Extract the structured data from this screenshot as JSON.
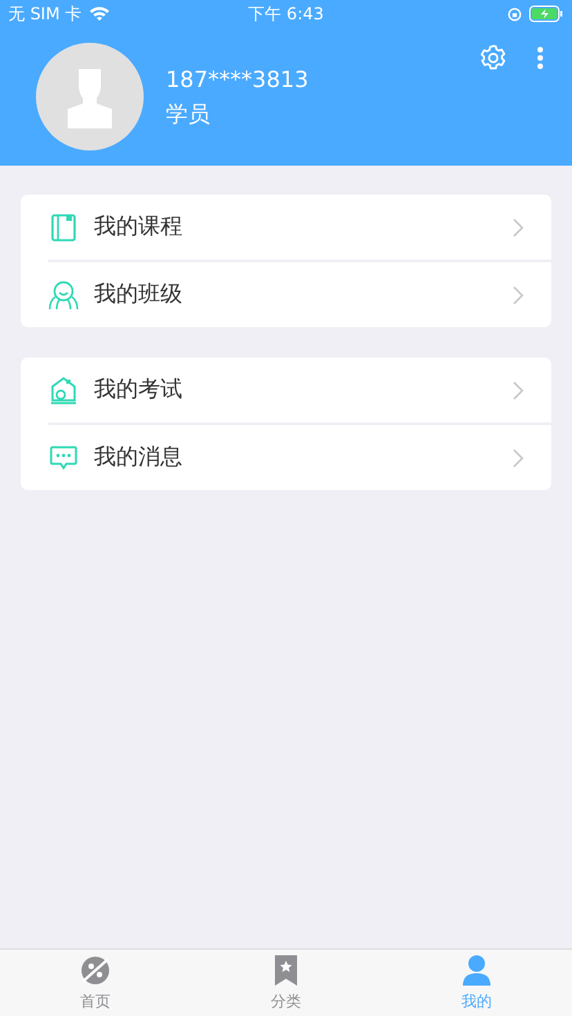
{
  "status_bar": {
    "carrier": "无 SIM 卡",
    "time": "下午 6:43"
  },
  "profile": {
    "phone": "187****3813",
    "role": "学员"
  },
  "menu_groups": [
    {
      "items": [
        {
          "label": "我的课程",
          "kind": "book"
        },
        {
          "label": "我的班级",
          "kind": "people"
        }
      ]
    },
    {
      "items": [
        {
          "label": "我的考试",
          "kind": "exam"
        },
        {
          "label": "我的消息",
          "kind": "message"
        }
      ]
    }
  ],
  "tab_bar": [
    {
      "label": "首页",
      "kind": "home",
      "selected": false
    },
    {
      "label": "分类",
      "kind": "category",
      "selected": false
    },
    {
      "label": "我的",
      "kind": "mine",
      "selected": true
    }
  ]
}
